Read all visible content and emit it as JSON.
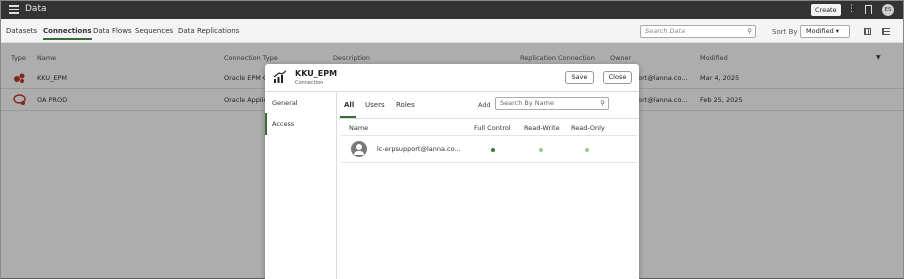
{
  "app": {
    "title": "Data",
    "create_label": "Create",
    "kebab": "⋮",
    "avatar_initials": "ES"
  },
  "tabs": [
    "Datasets",
    "Connections",
    "Data Flows",
    "Sequences",
    "Data Replications"
  ],
  "active_tab": "Connections",
  "search": {
    "placeholder": "Search Data"
  },
  "sort": {
    "label": "Sort By",
    "value": "Modified ▾"
  },
  "table": {
    "headers": {
      "type": "Type",
      "name": "Name",
      "connection_type": "Connection Type",
      "description": "Description",
      "replication": "Replication Connection",
      "owner": "Owner",
      "modified": "Modified"
    },
    "rows": [
      {
        "name": "KKU_EPM",
        "connection_type": "Oracle EPM C",
        "owner": "port@lanna.co...",
        "modified": "Mar 4, 2025"
      },
      {
        "name": "OA PROD",
        "connection_type": "Oracle Applic",
        "owner": "port@lanna.co...",
        "modified": "Feb 25, 2025"
      }
    ]
  },
  "dialog": {
    "title": "KKU_EPM",
    "subtitle": "Connection",
    "save_label": "Save",
    "close_label": "Close",
    "side": [
      "General",
      "Access"
    ],
    "subtabs": [
      "All",
      "Users",
      "Roles"
    ],
    "add_label": "Add",
    "search_placeholder": "Search By Name",
    "columns": {
      "name": "Name",
      "full": "Full Control",
      "rw": "Read-Write",
      "ro": "Read-Only"
    },
    "user": {
      "name": "lc-erpsupport@lanna.co...",
      "permission": "Full Control"
    },
    "colors": {
      "selected": "#3d7a3d",
      "unselected": "#9ccf8c",
      "accent": "#3a6b3a"
    }
  }
}
